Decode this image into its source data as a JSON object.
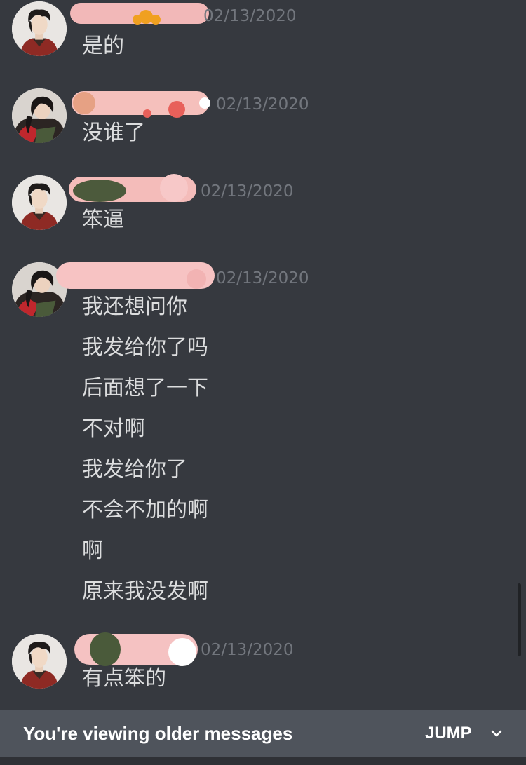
{
  "messages": [
    {
      "avatar_icon": "male-avatar-icon",
      "timestamp": "02/13/2020",
      "lines": [
        "是的"
      ]
    },
    {
      "avatar_icon": "female-avatar-icon",
      "timestamp": "02/13/2020",
      "lines": [
        "没谁了"
      ]
    },
    {
      "avatar_icon": "male-avatar-icon",
      "timestamp": "02/13/2020",
      "lines": [
        "笨逼"
      ]
    },
    {
      "avatar_icon": "female-avatar-icon",
      "timestamp": "02/13/2020",
      "lines": [
        "我还想问你",
        "我发给你了吗",
        "后面想了一下",
        "不对啊",
        "我发给你了",
        "不会不加的啊",
        "啊",
        "原来我没发啊"
      ]
    },
    {
      "avatar_icon": "male-avatar-icon",
      "timestamp": "02/13/2020",
      "lines": [
        "有点笨的"
      ]
    }
  ],
  "notice": {
    "text": "You're viewing older messages",
    "jump_label": "JUMP",
    "jump_icon": "chevron-down-icon"
  },
  "colors": {
    "background": "#36393f",
    "text": "#dcddde",
    "timestamp": "#72767d",
    "notice_bar": "#4f545c"
  }
}
